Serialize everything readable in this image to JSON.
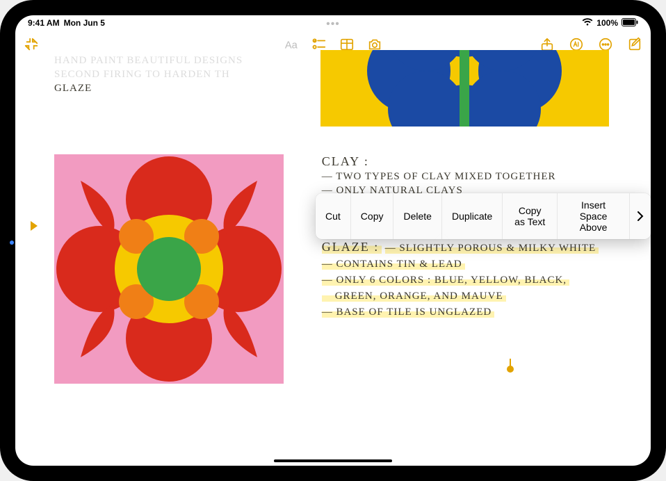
{
  "status": {
    "time": "9:41 AM",
    "date": "Mon Jun 5",
    "battery_percent": "100%"
  },
  "toolbar": {
    "collapse_icon": "collapse",
    "format_icon": "Aa",
    "checklist_icon": "checklist",
    "table_icon": "table",
    "camera_icon": "camera",
    "share_icon": "share",
    "markup_icon": "markup",
    "more_icon": "more",
    "compose_icon": "compose"
  },
  "top_left_notes": {
    "line1": "HAND PAINT BEAUTIFUL DESIGNS",
    "line2": "SECOND FIRING TO HARDEN TH",
    "line3": "GLAZE"
  },
  "clay": {
    "title": "CLAY :",
    "lines": [
      "— TWO TYPES OF CLAY MIXED TOGETHER",
      "— ONLY NATURAL CLAYS"
    ]
  },
  "glaze": {
    "title": "GLAZE :",
    "lines": [
      "— SLIGHTLY POROUS & MILKY WHITE",
      "— CONTAINS TIN & LEAD",
      "— ONLY 6 COLORS : BLUE, YELLOW, BLACK,",
      "    GREEN, ORANGE, AND MAUVE",
      "— BASE OF TILE IS UNGLAZED"
    ]
  },
  "context_menu": {
    "items": [
      "Cut",
      "Copy",
      "Delete",
      "Duplicate",
      "Copy as Text",
      "Insert Space Above"
    ]
  },
  "colors": {
    "accent": "#e2a300",
    "pink": "#f29bc1",
    "red": "#d92a1c",
    "orange": "#f07f16",
    "green": "#3aa548",
    "yellow": "#f6c900",
    "blue": "#1b4aa4"
  }
}
